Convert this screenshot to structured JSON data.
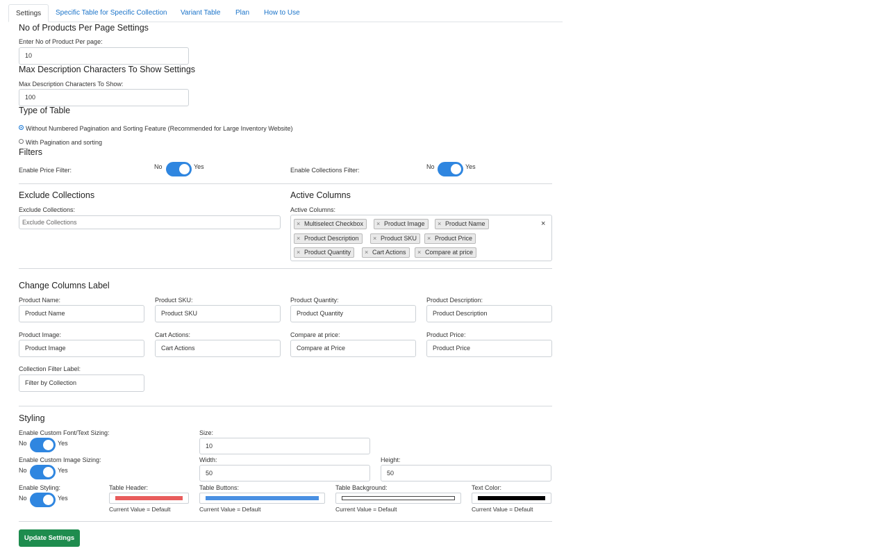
{
  "tabs": [
    "Settings",
    "Specific Table for Specific Collection",
    "Variant Table",
    "Plan",
    "How to Use"
  ],
  "per_page": {
    "heading": "No of Products Per Page Settings",
    "label": "Enter No of Product Per page:",
    "value": "10"
  },
  "max_desc": {
    "heading": "Max Description Characters To Show Settings",
    "label": "Max Description Characters To Show:",
    "value": "100"
  },
  "table_type": {
    "heading": "Type of Table",
    "options": [
      {
        "label": "Without Numbered Pagination and Sorting Feature (Recommended for Large Inventory Website)",
        "selected": true
      },
      {
        "label": "With Pagination and sorting",
        "selected": false
      }
    ]
  },
  "filters": {
    "heading": "Filters",
    "price_label": "Enable Price Filter:",
    "collections_label": "Enable Collections Filter:",
    "no": "No",
    "yes": "Yes"
  },
  "exclude": {
    "heading": "Exclude Collections",
    "label": "Exclude Collections:",
    "placeholder": "Exclude Collections"
  },
  "active_columns": {
    "heading": "Active Columns",
    "label": "Active Columns:",
    "chips": [
      "Multiselect Checkbox",
      "Product Image",
      "Product Name",
      "Product Description",
      "Product SKU",
      "Product Price",
      "Product Quantity",
      "Cart Actions",
      "Compare at price"
    ],
    "remove_glyph": "×",
    "clear_glyph": "×"
  },
  "labels": {
    "heading": "Change Columns Label",
    "fields": [
      {
        "label": "Product Name:",
        "value": "Product Name"
      },
      {
        "label": "Product SKU:",
        "value": "Product SKU"
      },
      {
        "label": "Product Quantity:",
        "value": "Product Quantity"
      },
      {
        "label": "Product Description:",
        "value": "Product Description"
      },
      {
        "label": "Product Image:",
        "value": "Product Image"
      },
      {
        "label": "Cart Actions:",
        "value": "Cart Actions"
      },
      {
        "label": "Compare at price:",
        "value": "Compare at Price"
      },
      {
        "label": "Product Price:",
        "value": "Product Price"
      },
      {
        "label": "Collection Filter Label:",
        "value": "Filter by Collection"
      }
    ]
  },
  "styling": {
    "heading": "Styling",
    "font_label": "Enable Custom Font/Text Sizing:",
    "size_label": "Size:",
    "size_value": "10",
    "image_label": "Enable Custom Image Sizing:",
    "width_label": "Width:",
    "width_value": "50",
    "height_label": "Height:",
    "height_value": "50",
    "enable_label": "Enable Styling:",
    "colors": [
      {
        "label": "Table Header:",
        "color": "#e85c5c",
        "note": "Current Value = Default"
      },
      {
        "label": "Table Buttons:",
        "color": "#4a90e2",
        "note": "Current Value = Default"
      },
      {
        "label": "Table Background:",
        "color": "#ffffff",
        "note": "Current Value = Default"
      },
      {
        "label": "Text Color:",
        "color": "#000000",
        "note": "Current Value = Default"
      }
    ]
  },
  "update_button": "Update Settings"
}
